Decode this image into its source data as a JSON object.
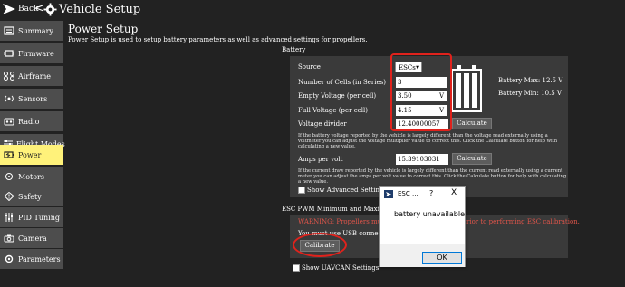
{
  "topbar": {
    "back_label": "Back",
    "back_arrow": "<",
    "title": "Vehicle Setup"
  },
  "sidebar": {
    "items": [
      {
        "label": "Summary",
        "icon": "summary-icon"
      },
      {
        "label": "Firmware",
        "icon": "firmware-icon"
      },
      {
        "label": "Airframe",
        "icon": "airframe-icon"
      },
      {
        "label": "Sensors",
        "icon": "sensors-icon"
      },
      {
        "label": "Radio",
        "icon": "radio-icon"
      },
      {
        "label": "Flight Modes",
        "icon": "flight-modes-icon"
      },
      {
        "label": "Power",
        "icon": "power-icon",
        "active": true
      },
      {
        "label": "Motors",
        "icon": "motors-icon"
      },
      {
        "label": "Safety",
        "icon": "safety-icon"
      },
      {
        "label": "PID Tuning",
        "icon": "pid-tuning-icon"
      },
      {
        "label": "Camera",
        "icon": "camera-icon"
      },
      {
        "label": "Parameters",
        "icon": "parameters-icon"
      }
    ]
  },
  "main": {
    "title": "Power Setup",
    "description": "Power Setup is used to setup battery parameters as well as advanced settings for propellers."
  },
  "battery": {
    "header": "Battery",
    "source_label": "Source",
    "source_value": "ESCs",
    "cells_label": "Number of Cells (in Series)",
    "cells_value": "3",
    "empty_label": "Empty Voltage (per cell)",
    "empty_value": "3.50",
    "empty_unit": "V",
    "full_label": "Full Voltage (per cell)",
    "full_value": "4.15",
    "full_unit": "V",
    "divider_label": "Voltage divider",
    "divider_value": "12.40000057",
    "calculate_label": "Calculate",
    "divider_help": "If the battery voltage reported by the vehicle is largely different than the voltage read externally using a voltmeter you can adjust the voltage multiplier value to correct this. Click the Calculate button for help with calculating a new value.",
    "amps_label": "Amps per volt",
    "amps_value": "15.39103031",
    "amps_help": "If the current draw reported by the vehicle is largely different than the current read externally using a current meter you can adjust the amps per volt value to correct this. Click the Calculate button for help with calculating a new value.",
    "battery_max": "Battery Max:  12.5 V",
    "battery_min": "Battery Min:  10.5 V",
    "advanced_label": "Show Advanced Settings"
  },
  "esc": {
    "header": "ESC PWM Minimum and Maximum Calibration",
    "warning": "WARNING: Propellers mus",
    "warning_tail": "rior to performing ESC calibration.",
    "usb_note": "You must use USB connec",
    "calibrate_label": "Calibrate",
    "uavcan_label": "Show UAVCAN Settings"
  },
  "dialog": {
    "title": "ESC ...",
    "help": "?",
    "close": "X",
    "message": "battery unavailable",
    "ok_label": "OK"
  },
  "colors": {
    "background": "#222222",
    "sidebar_item": "#4d4d4d",
    "active_item": "#fff27a",
    "panel": "#3a3a3a",
    "annotation_red": "#e0221c",
    "warning_red": "#e0554a"
  }
}
